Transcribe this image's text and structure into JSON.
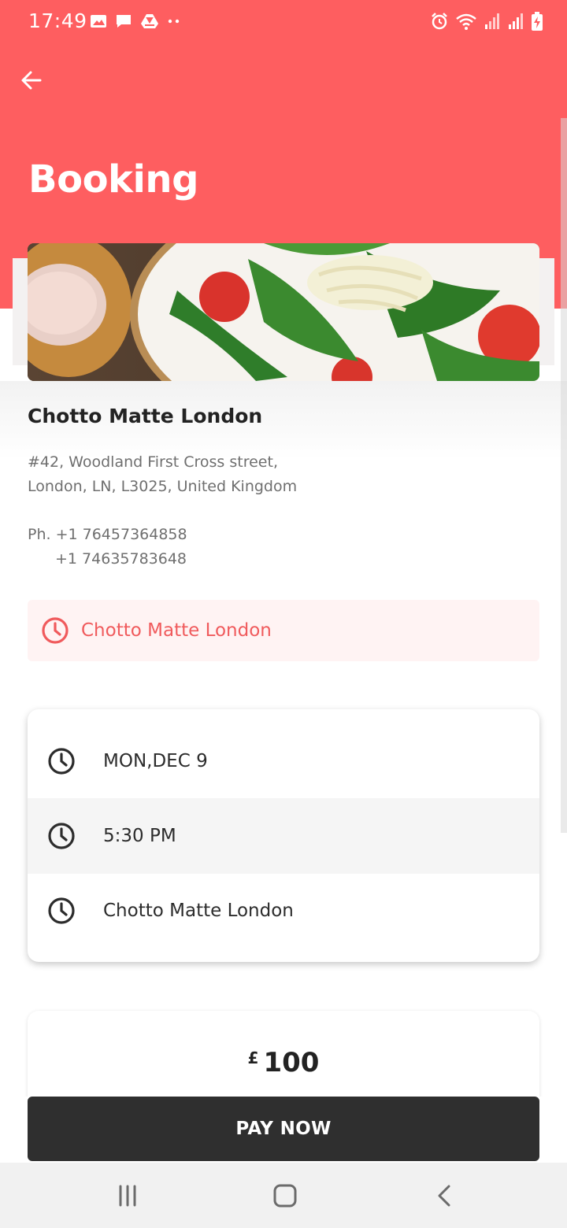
{
  "status_bar": {
    "time": "17:49",
    "left_icons": [
      "image-icon",
      "message-icon",
      "drive-icon",
      "more-dots-icon"
    ],
    "right_icons": [
      "alarm-icon",
      "wifi-icon",
      "signal-icon",
      "signal-icon",
      "battery-charging-icon"
    ]
  },
  "header": {
    "back_icon": "arrow-left-icon",
    "title": "Booking"
  },
  "restaurant": {
    "name": "Chotto Matte London",
    "address_line1": "#42, Woodland First Cross street,",
    "address_line2": "London, LN, L3025, United Kingdom",
    "phone_line1": "Ph. +1 76457364858",
    "phone_line2": "+1 74635783648"
  },
  "notice": {
    "icon": "clock-icon",
    "text": "Chotto Matte London"
  },
  "details": {
    "rows": [
      {
        "icon": "clock-icon",
        "text": "MON,DEC 9"
      },
      {
        "icon": "clock-icon",
        "text": "5:30 PM"
      },
      {
        "icon": "clock-icon",
        "text": "Chotto Matte London"
      }
    ]
  },
  "price": {
    "currency": "£",
    "amount": "100"
  },
  "pay_button": {
    "label": "PAY NOW"
  },
  "nav_bar": {
    "icons": [
      "recent-apps-icon",
      "home-icon",
      "back-chevron-icon"
    ]
  },
  "colors": {
    "accent": "#fe5e60",
    "notice_bg": "#fff3f3",
    "notice_text": "#f05a5c",
    "button_bg": "#2f2f2f",
    "nav_bg": "#f1f1f1"
  }
}
